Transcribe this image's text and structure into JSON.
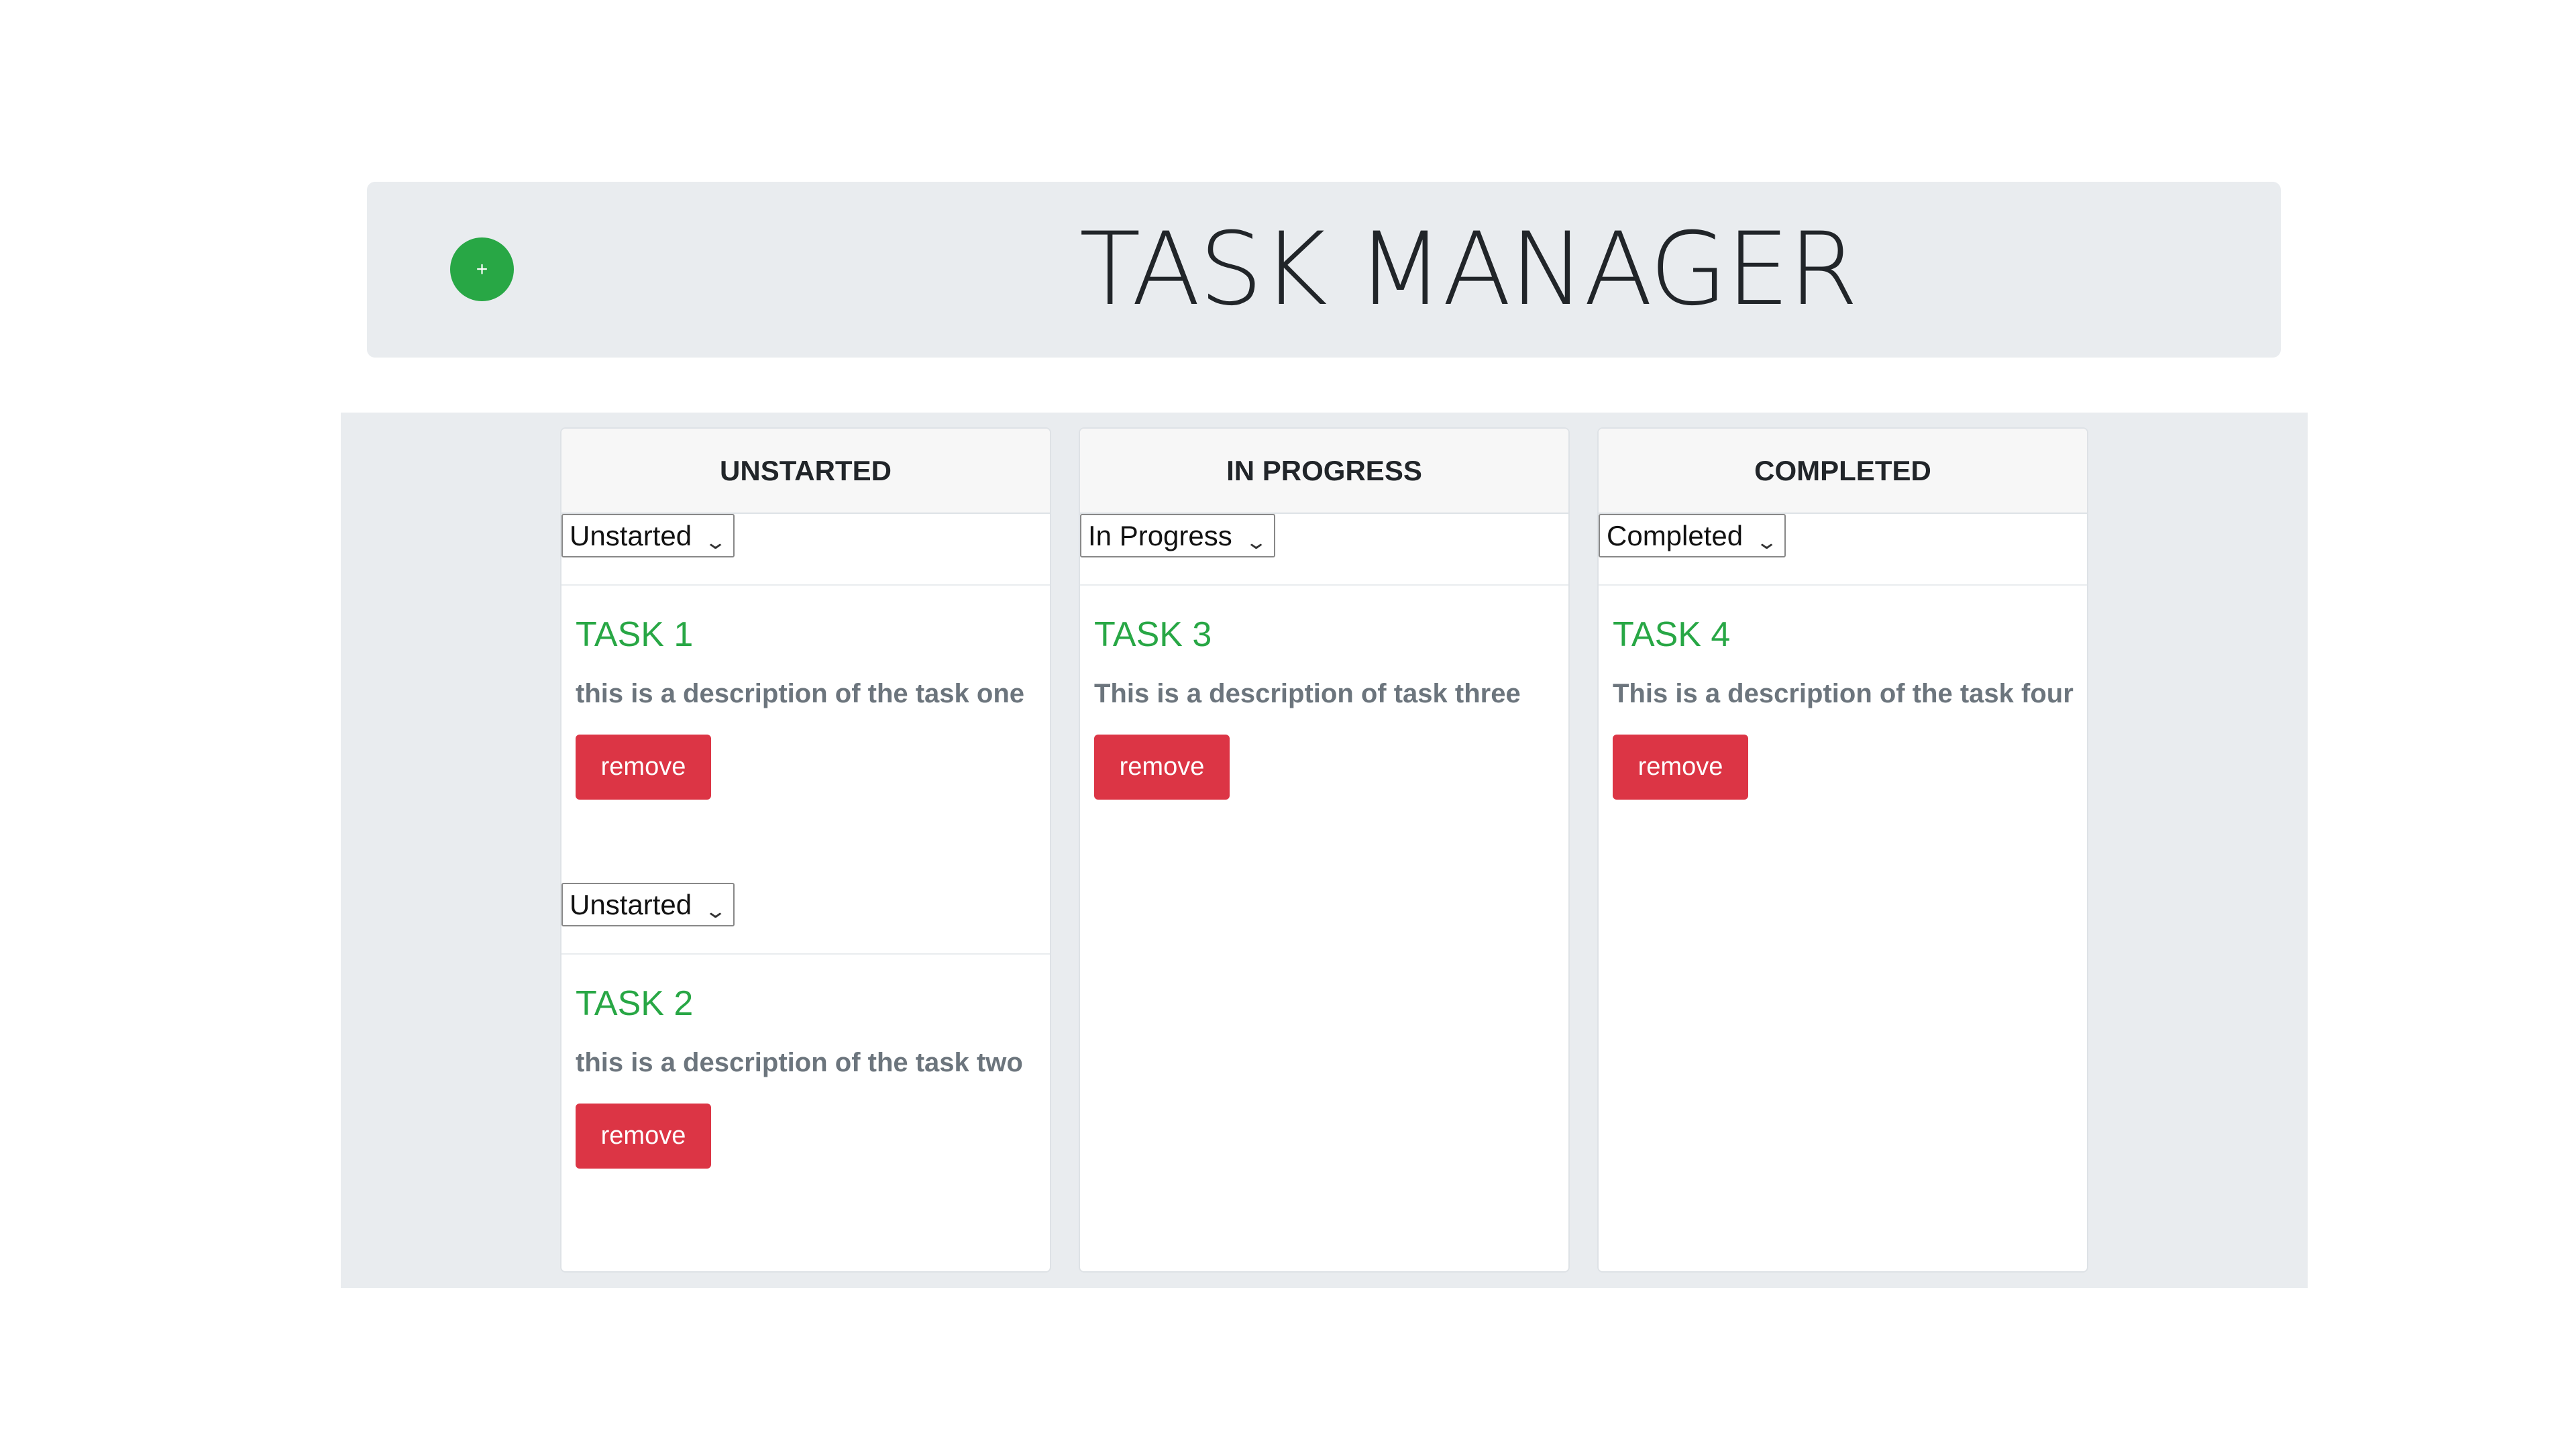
{
  "header": {
    "title": "TASK MANAGER",
    "add_label": "+",
    "add_color": "#28a745"
  },
  "colors": {
    "header_bg": "#e9ecef",
    "task_title": "#28a745",
    "remove_button": "#dc3545",
    "description": "#6c757d"
  },
  "columns": [
    {
      "title": "UNSTARTED",
      "tasks": [
        {
          "status": "Unstarted",
          "title": "TASK 1",
          "description": "this is a description of the task one",
          "remove_label": "remove"
        },
        {
          "status": "Unstarted",
          "title": "TASK 2",
          "description": "this is a description of the task two",
          "remove_label": "remove"
        }
      ]
    },
    {
      "title": "IN PROGRESS",
      "tasks": [
        {
          "status": "In Progress",
          "title": "TASK 3",
          "description": "This is a description of task three",
          "remove_label": "remove"
        }
      ]
    },
    {
      "title": "COMPLETED",
      "tasks": [
        {
          "status": "Completed",
          "title": "TASK 4",
          "description": "This is a description of the task four",
          "remove_label": "remove"
        }
      ]
    }
  ]
}
